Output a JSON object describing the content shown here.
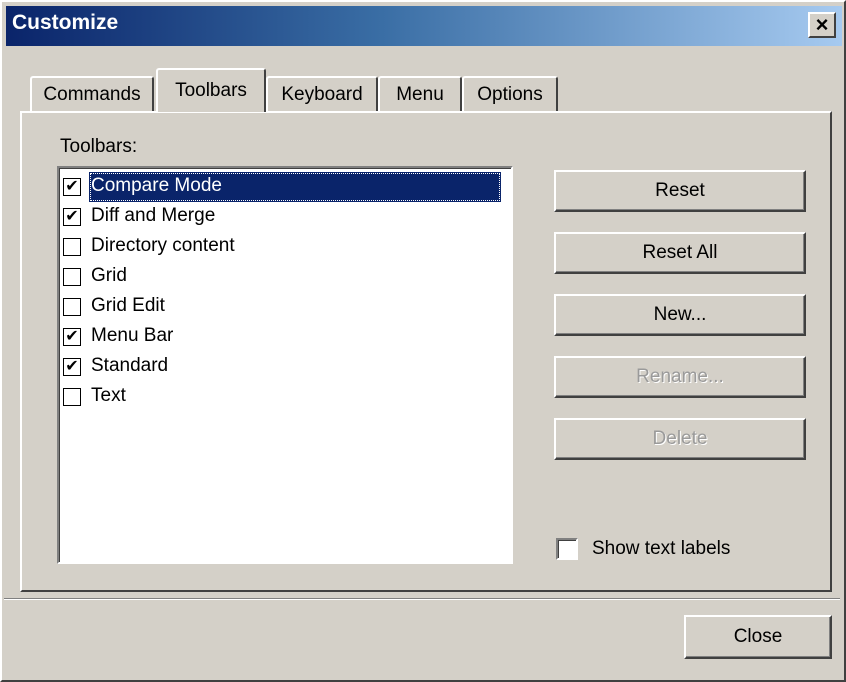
{
  "window": {
    "title": "Customize",
    "close_glyph": "×"
  },
  "tabs": [
    {
      "label": "Commands",
      "active": false
    },
    {
      "label": "Toolbars",
      "active": true
    },
    {
      "label": "Keyboard",
      "active": false
    },
    {
      "label": "Menu",
      "active": false
    },
    {
      "label": "Options",
      "active": false
    }
  ],
  "toolbars_label": "Toolbars:",
  "toolbar_list": [
    {
      "label": "Compare Mode",
      "checked": true,
      "selected": true
    },
    {
      "label": "Diff and Merge",
      "checked": true,
      "selected": false
    },
    {
      "label": "Directory content",
      "checked": false,
      "selected": false
    },
    {
      "label": "Grid",
      "checked": false,
      "selected": false
    },
    {
      "label": "Grid Edit",
      "checked": false,
      "selected": false
    },
    {
      "label": "Menu Bar",
      "checked": true,
      "selected": false
    },
    {
      "label": "Standard",
      "checked": true,
      "selected": false
    },
    {
      "label": "Text",
      "checked": false,
      "selected": false
    }
  ],
  "buttons": {
    "reset": "Reset",
    "reset_all": "Reset All",
    "new": "New...",
    "rename": "Rename...",
    "delete": "Delete",
    "close": "Close"
  },
  "show_text_labels": {
    "label": "Show text labels",
    "checked": false
  },
  "colors": {
    "dialog_bg": "#d4d0c8",
    "title_gradient_start": "#0a246a",
    "title_gradient_end": "#a6caf0",
    "selection": "#0a246a"
  },
  "icons": {
    "check": "check-icon",
    "close": "close-icon"
  }
}
